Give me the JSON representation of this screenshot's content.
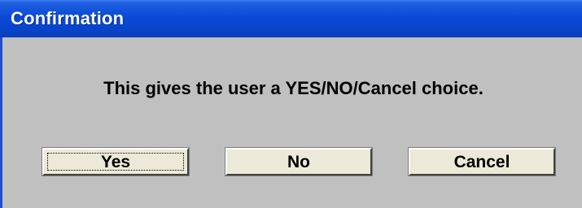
{
  "window": {
    "title": "Confirmation"
  },
  "dialog": {
    "message": "This gives the user a YES/NO/Cancel choice."
  },
  "buttons": {
    "yes_label": "Yes",
    "no_label": "No",
    "cancel_label": "Cancel"
  },
  "colors": {
    "titlebar": "#0a4ad8",
    "dialog_background": "#c0c0c0",
    "button_face": "#ece9d8"
  }
}
